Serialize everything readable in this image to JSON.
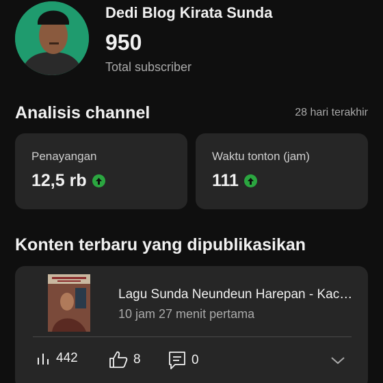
{
  "channel": {
    "name": "Dedi Blog Kirata Sunda",
    "subscriber_count": "950",
    "subscriber_label": "Total subscriber"
  },
  "analytics": {
    "title": "Analisis channel",
    "range": "28 hari terakhir",
    "cards": [
      {
        "label": "Penayangan",
        "value": "12,5 rb",
        "trend": "up"
      },
      {
        "label": "Waktu tonton (jam)",
        "value": "111",
        "trend": "up"
      }
    ]
  },
  "latest": {
    "title": "Konten terbaru yang dipublikasikan",
    "video": {
      "title": "Lagu Sunda Neundeun Harepan - Kacapi Suling",
      "meta": "10 jam 27 menit pertama",
      "views": "442",
      "likes": "8",
      "comments": "0"
    }
  },
  "colors": {
    "background": "#0f0f0f",
    "card": "#262626",
    "trend_up": "#2ba640",
    "avatar_bg": "#1f9b6e"
  },
  "icons": [
    "views-bar-icon",
    "thumbs-up-icon",
    "comment-icon",
    "chevron-down-icon",
    "trend-up-icon"
  ]
}
